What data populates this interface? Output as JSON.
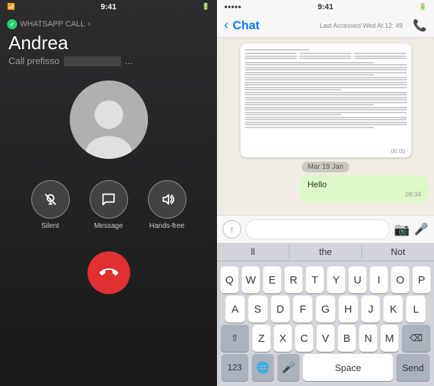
{
  "left": {
    "status_bar": {
      "time": "9:41",
      "signal": "●●●●",
      "wifi": "WiFi",
      "battery": "100%"
    },
    "call_label": "WHATSAPP CALL",
    "caller_name": "Andrea",
    "call_subtitle": "Call prefisso",
    "buttons": {
      "silent": "Silent",
      "message": "Message",
      "handsfree": "Hands-free"
    }
  },
  "right": {
    "status_bar": {
      "time": "9:41",
      "signal": "●●●●●",
      "wifi": "WiFi",
      "battery": "100%"
    },
    "header": {
      "back_label": "Chat",
      "last_accessed": "Last Accessed Wed At 12: 49",
      "phone_icon": "📞"
    },
    "messages": [
      {
        "type": "document",
        "timestamp": "00:00"
      }
    ],
    "date_divider": "Mar 19 Jan",
    "hello_message": {
      "text": "Hello",
      "time": "09:34"
    },
    "input": {
      "placeholder": ""
    },
    "keyboard": {
      "suggestions": [
        "ll",
        "the",
        "Not"
      ],
      "row1": [
        "Q",
        "W",
        "E",
        "R",
        "T",
        "Y",
        "U",
        "I",
        "O",
        "P"
      ],
      "row2": [
        "A",
        "S",
        "D",
        "F",
        "G",
        "H",
        "J",
        "K",
        "L"
      ],
      "row3": [
        "Z",
        "X",
        "C",
        "V",
        "B",
        "N",
        "M"
      ],
      "shift": "⇧",
      "backspace": "⌫",
      "num": "123",
      "globe": "🌐",
      "mic": "🎤",
      "space": "Space",
      "send": "Send"
    }
  }
}
